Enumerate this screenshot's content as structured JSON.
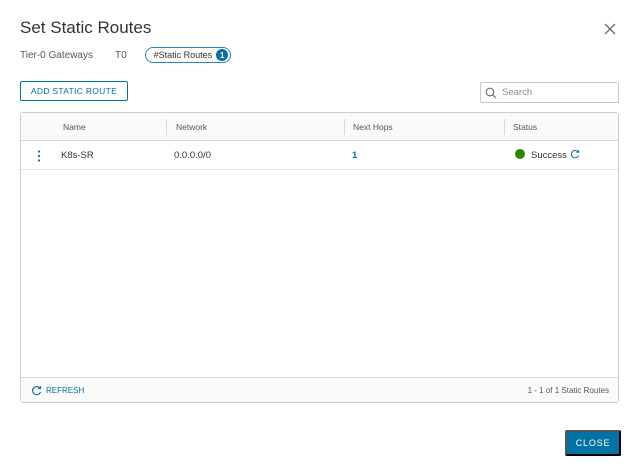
{
  "dialog": {
    "title": "Set Static Routes",
    "close_icon": "close-icon"
  },
  "breadcrumb": {
    "gateway_type": "Tier-0 Gateways",
    "gateway_name": "T0",
    "pill_label": "#Static Routes",
    "pill_count": "1"
  },
  "toolbar": {
    "add_label": "ADD STATIC ROUTE",
    "search_placeholder": "Search"
  },
  "table": {
    "columns": [
      "Name",
      "Network",
      "Next Hops",
      "Status"
    ],
    "rows": [
      {
        "name": "K8s-SR",
        "network": "0.0.0.0/0",
        "next_hops": "1",
        "status": "Success",
        "status_color": "#2f8400"
      }
    ]
  },
  "footer": {
    "refresh_label": "REFRESH",
    "count_text": "1 - 1 of 1 Static Routes"
  },
  "actions": {
    "close_label": "CLOSE"
  },
  "colors": {
    "accent": "#0072a3",
    "success": "#2f8400"
  }
}
